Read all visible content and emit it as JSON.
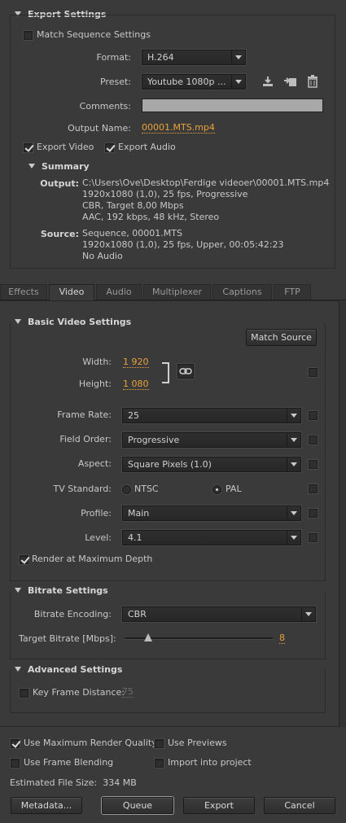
{
  "export_settings": {
    "title": "Export Settings",
    "match_sequence_label": "Match Sequence Settings",
    "format_label": "Format:",
    "format_value": "H.264",
    "preset_label": "Preset:",
    "preset_value": "Youtube 1080p ...",
    "comments_label": "Comments:",
    "comments_value": "",
    "output_name_label": "Output Name:",
    "output_name_value": "00001.MTS.mp4",
    "export_video_label": "Export Video",
    "export_audio_label": "Export Audio",
    "export_video_checked": true,
    "export_audio_checked": true
  },
  "summary": {
    "title": "Summary",
    "output_label": "Output:",
    "output_lines": [
      "C:\\Users\\Ove\\Desktop\\Ferdige videoer\\00001.MTS.mp4",
      "1920x1080 (1,0), 25 fps, Progressive",
      "CBR, Target 8,00 Mbps",
      "AAC, 192 kbps, 48 kHz, Stereo"
    ],
    "source_label": "Source:",
    "source_lines": [
      "Sequence, 00001.MTS",
      "1920x1080 (1,0), 25 fps, Upper, 00:05:42:23",
      "No Audio"
    ]
  },
  "tabs": [
    "Effects",
    "Video",
    "Audio",
    "Multiplexer",
    "Captions",
    "FTP"
  ],
  "active_tab": "Video",
  "basic_video": {
    "title": "Basic Video Settings",
    "match_source_label": "Match Source",
    "width_label": "Width:",
    "width_value": "1 920",
    "height_label": "Height:",
    "height_value": "1 080",
    "frame_rate_label": "Frame Rate:",
    "frame_rate_value": "25",
    "field_order_label": "Field Order:",
    "field_order_value": "Progressive",
    "aspect_label": "Aspect:",
    "aspect_value": "Square Pixels (1.0)",
    "tv_standard_label": "TV Standard:",
    "ntsc_label": "NTSC",
    "pal_label": "PAL",
    "tv_standard_selected": "PAL",
    "profile_label": "Profile:",
    "profile_value": "Main",
    "level_label": "Level:",
    "level_value": "4.1",
    "render_max_depth_label": "Render at Maximum Depth",
    "render_max_depth_checked": true
  },
  "bitrate": {
    "title": "Bitrate Settings",
    "encoding_label": "Bitrate Encoding:",
    "encoding_value": "CBR",
    "target_label": "Target Bitrate [Mbps]:",
    "target_value": "8",
    "target_fraction": 0.16
  },
  "advanced": {
    "title": "Advanced Settings",
    "key_frame_label": "Key Frame Distance:",
    "key_frame_value": "75"
  },
  "bottom": {
    "max_render_quality_label": "Use Maximum Render Quality",
    "max_render_quality_checked": true,
    "use_previews_label": "Use Previews",
    "frame_blending_label": "Use Frame Blending",
    "import_project_label": "Import into project",
    "est_size_label": "Estimated File Size:",
    "est_size_value": "334 MB",
    "metadata_label": "Metadata...",
    "queue_label": "Queue",
    "export_label": "Export",
    "cancel_label": "Cancel"
  },
  "colors": {
    "background": "#3a3a3a",
    "accent_link": "#e8a33a",
    "text": "#c8c8c8"
  }
}
